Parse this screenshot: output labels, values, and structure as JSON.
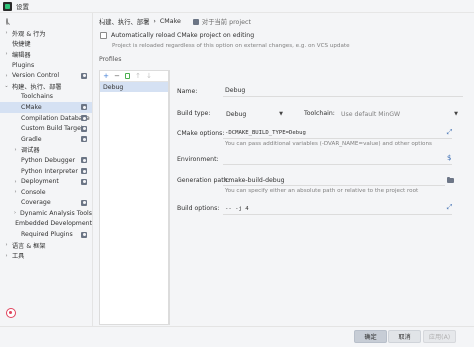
{
  "window": {
    "title": "设置"
  },
  "search": {
    "placeholder": ""
  },
  "sidebar": {
    "items": [
      {
        "label": "外观 & 行为",
        "arrow": "›",
        "indent": 0
      },
      {
        "label": "快捷键",
        "arrow": "",
        "indent": 0
      },
      {
        "label": "编辑器",
        "arrow": "›",
        "indent": 0
      },
      {
        "label": "Plugins",
        "arrow": "",
        "indent": 0
      },
      {
        "label": "Version Control",
        "arrow": "›",
        "indent": 0,
        "proj": true
      },
      {
        "label": "构建、执行、部署",
        "arrow": "⌄",
        "indent": 0
      },
      {
        "label": "Toolchains",
        "arrow": "",
        "indent": 1
      },
      {
        "label": "CMake",
        "arrow": "",
        "indent": 1,
        "proj": true,
        "selected": true
      },
      {
        "label": "Compilation Database",
        "arrow": "",
        "indent": 1,
        "proj": true
      },
      {
        "label": "Custom Build Targets",
        "arrow": "",
        "indent": 1,
        "proj": true
      },
      {
        "label": "Gradle",
        "arrow": "",
        "indent": 1,
        "proj": true
      },
      {
        "label": "调试器",
        "arrow": "›",
        "indent": 1
      },
      {
        "label": "Python Debugger",
        "arrow": "",
        "indent": 1,
        "proj": true
      },
      {
        "label": "Python Interpreter",
        "arrow": "",
        "indent": 1,
        "proj": true
      },
      {
        "label": "Deployment",
        "arrow": "›",
        "indent": 1,
        "proj": true
      },
      {
        "label": "Console",
        "arrow": "›",
        "indent": 1
      },
      {
        "label": "Coverage",
        "arrow": "",
        "indent": 1,
        "proj": true
      },
      {
        "label": "Dynamic Analysis Tools",
        "arrow": "›",
        "indent": 1
      },
      {
        "label": "Embedded Development",
        "arrow": "",
        "indent": 1
      },
      {
        "label": "Required Plugins",
        "arrow": "",
        "indent": 1,
        "proj": true
      },
      {
        "label": "语言 & 框架",
        "arrow": "›",
        "indent": 0
      },
      {
        "label": "工具",
        "arrow": "›",
        "indent": 0
      }
    ]
  },
  "breadcrumb": {
    "parent": "构建、执行、部署",
    "separator": "›",
    "current": "CMake",
    "project_note": "对于当前 project"
  },
  "auto_reload": {
    "label": "Automatically reload CMake project on editing",
    "checked": false,
    "hint": "Project is reloaded regardless of this option on external changes, e.g. on VCS update"
  },
  "profiles": {
    "section_label": "Profiles",
    "toolbar": {
      "add": "+",
      "remove": "−",
      "up": "↑",
      "down": "↓"
    },
    "items": [
      "Debug"
    ]
  },
  "form": {
    "name_label": "Name:",
    "name_value": "Debug",
    "build_type_label": "Build type:",
    "build_type_value": "Debug",
    "toolchain_label": "Toolchain:",
    "toolchain_value": "Use default  MinGW",
    "cmake_options_label": "CMake options:",
    "cmake_options_value": "-DCMAKE_BUILD_TYPE=Debug",
    "cmake_options_hint": "You can pass additional variables (-DVAR_NAME=value) and other options",
    "environment_label": "Environment:",
    "generation_path_label": "Generation path:",
    "generation_path_value": "cmake-build-debug",
    "generation_path_hint": "You can specify either an absolute path or relative to the project root",
    "build_options_label": "Build options:",
    "build_options_value": "-- -j 4"
  },
  "buttons": {
    "ok": "确定",
    "cancel": "取消",
    "apply": "应用(A)"
  },
  "colors": {
    "selection": "#d5e1f3",
    "accent": "#4a77b7"
  }
}
